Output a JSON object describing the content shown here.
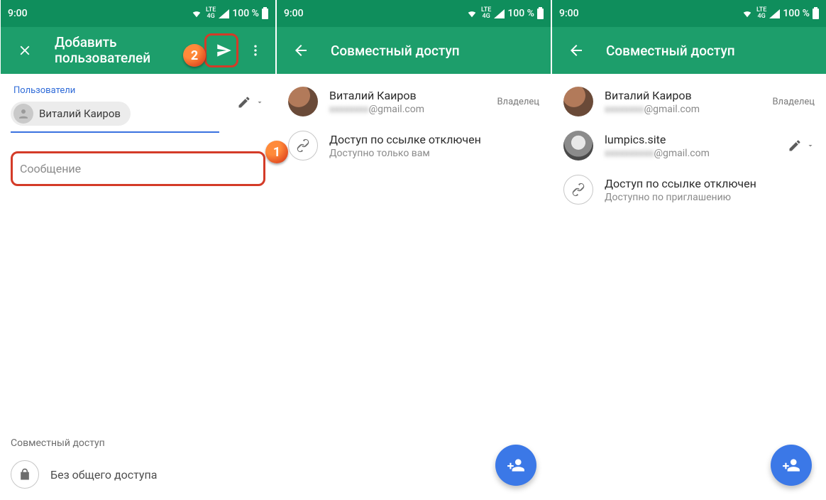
{
  "statusbar": {
    "time": "9:00",
    "lte_top": "LTE",
    "lte_bot": "4G",
    "battery": "100 %"
  },
  "screen1": {
    "title_line1": "Добавить",
    "title_line2": "пользователей",
    "users_label": "Пользователи",
    "chip_name": "Виталий Каиров",
    "message_placeholder": "Сообщение",
    "share_label": "Совместный доступ",
    "no_access": "Без общего доступа"
  },
  "screen2": {
    "title": "Совместный доступ",
    "user_name": "Виталий Каиров",
    "user_email_suffix": "@gmail.com",
    "role": "Владелец",
    "link_title": "Доступ по ссылке отключен",
    "link_sub": "Доступно только вам"
  },
  "screen3": {
    "title": "Совместный доступ",
    "user1_name": "Виталий Каиров",
    "user1_email_suffix": "@gmail.com",
    "user1_role": "Владелец",
    "user2_name": "lumpics.site",
    "user2_email_suffix": "@gmail.com",
    "link_title": "Доступ по ссылке отключен",
    "link_sub": "Доступно по приглашению"
  },
  "annotations": {
    "a1": "1",
    "a2": "2"
  }
}
